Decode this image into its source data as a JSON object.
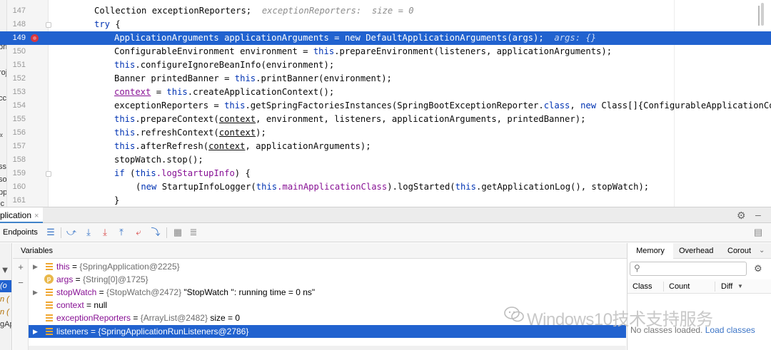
{
  "editor": {
    "left_strip_chars": [
      "pri",
      "",
      "roj",
      "",
      "cc",
      "",
      "«",
      "",
      "ss",
      "so",
      "pp",
      "ic"
    ],
    "lines": [
      {
        "no": "147"
      },
      {
        "no": "148"
      },
      {
        "no": "149"
      },
      {
        "no": "150"
      },
      {
        "no": "151"
      },
      {
        "no": "152"
      },
      {
        "no": "153"
      },
      {
        "no": "154"
      },
      {
        "no": "155"
      },
      {
        "no": "156"
      },
      {
        "no": "157"
      },
      {
        "no": "158"
      },
      {
        "no": "159"
      },
      {
        "no": "160"
      },
      {
        "no": "161"
      }
    ],
    "code": {
      "l147_a": "Collection exceptionReporters;",
      "l147_hint": "exceptionReporters:  size = 0",
      "l148_kw": "try",
      "l148_b": " {",
      "l149_a": "ApplicationArguments applicationArguments = new DefaultApplicationArguments(args);",
      "l149_hint": "args: {}",
      "l150_a": "ConfigurableEnvironment environment = ",
      "l150_kw": "this",
      "l150_b": ".prepareEnvironment(listeners, applicationArguments);",
      "l151_kw": "this",
      "l151_b": ".configureIgnoreBeanInfo(environment);",
      "l152_a": "Banner printedBanner = ",
      "l152_kw": "this",
      "l152_b": ".printBanner(environment);",
      "l153_u": "context",
      "l153_a": " = ",
      "l153_kw": "this",
      "l153_b": ".createApplicationContext();",
      "l154_a": "exceptionReporters = ",
      "l154_kw": "this",
      "l154_b": ".getSpringFactoriesInstances(SpringBootExceptionReporter.",
      "l154_kw2": "class",
      "l154_c": ", ",
      "l154_kw3": "new",
      "l154_d": " Class[]{ConfigurableApplicationCo",
      "l155_kw": "this",
      "l155_a": ".prepareContext(",
      "l155_u": "context",
      "l155_b": ", environment, listeners, applicationArguments, printedBanner);",
      "l156_kw": "this",
      "l156_a": ".refreshContext(",
      "l156_u": "context",
      "l156_b": ");",
      "l157_kw": "this",
      "l157_a": ".afterRefresh(",
      "l157_u": "context",
      "l157_b": ", applicationArguments);",
      "l158_a": "stopWatch.stop();",
      "l159_kw": "if",
      "l159_a": " (",
      "l159_kw2": "this",
      "l159_f": ".logStartupInfo",
      "l159_b": ") {",
      "l160_a": "(",
      "l160_kw": "new",
      "l160_b": " StartupInfoLogger(",
      "l160_kw2": "this",
      "l160_f": ".mainApplicationClass",
      "l160_c": ").logStarted(",
      "l160_kw3": "this",
      "l160_d": ".getApplicationLog(), stopWatch);",
      "l161_a": "}"
    }
  },
  "debug": {
    "tab_title": "plication",
    "tab_close": "×",
    "endpoints_label": "Endpoints",
    "variables_header": "Variables",
    "frames_strip": [
      "(o",
      "n (",
      "n (",
      "gAp"
    ],
    "variables": [
      {
        "name": "this",
        "eq": " = ",
        "type": "{SpringApplication@2225}",
        "extra": "",
        "expandable": true,
        "icon": "field"
      },
      {
        "name": "args",
        "eq": " = ",
        "type": "{String[0]@1725}",
        "extra": "",
        "expandable": false,
        "icon": "param"
      },
      {
        "name": "stopWatch",
        "eq": " = ",
        "type": "{StopWatch@2472}",
        "extra": " \"StopWatch '': running time = 0 ns\"",
        "expandable": true,
        "icon": "field"
      },
      {
        "name": "context",
        "eq": " = ",
        "type": "",
        "extra": "null",
        "expandable": false,
        "icon": "field"
      },
      {
        "name": "exceptionReporters",
        "eq": " = ",
        "type": "{ArrayList@2482}",
        "extra": "  size = 0",
        "expandable": false,
        "icon": "field"
      },
      {
        "name": "listeners",
        "eq": " = ",
        "type": "{SpringApplicationRunListeners@2786}",
        "extra": "",
        "expandable": true,
        "icon": "field",
        "selected": true
      }
    ],
    "param_badge": "p"
  },
  "memory": {
    "tabs": [
      "Memory",
      "Overhead",
      "Corout"
    ],
    "columns": [
      "Class",
      "Count",
      "Diff"
    ],
    "empty_text": "No classes loaded.",
    "load_link": "Load classes"
  },
  "watermark": "Windows10技术支持服务"
}
